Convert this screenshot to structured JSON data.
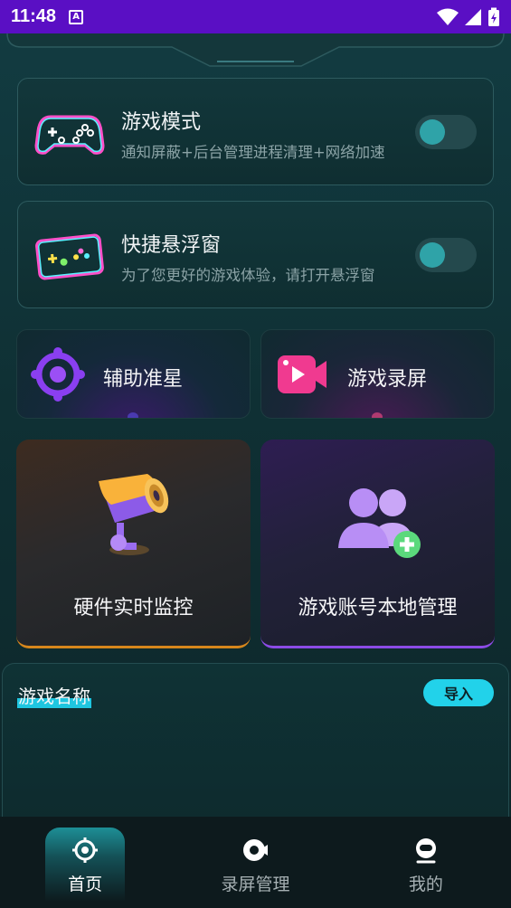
{
  "status_bar": {
    "time": "11:48",
    "notification_icon": "A"
  },
  "mode_cards": [
    {
      "title": "游戏模式",
      "subtitle": "通知屏蔽+后台管理进程清理+网络加速",
      "icon": "gamepad-icon",
      "toggle_on": false
    },
    {
      "title": "快捷悬浮窗",
      "subtitle": "为了您更好的游戏体验，请打开悬浮窗",
      "icon": "floating-window-icon",
      "toggle_on": false
    }
  ],
  "quick_cards": [
    {
      "label": "辅助准星",
      "icon": "crosshair-icon",
      "accent": "#8a3ff0"
    },
    {
      "label": "游戏录屏",
      "icon": "video-record-icon",
      "accent": "#ff3d9a"
    }
  ],
  "feature_cards": [
    {
      "label": "硬件实时监控",
      "icon": "camera-monitor-icon",
      "accent": "#d6861c"
    },
    {
      "label": "游戏账号本地管理",
      "icon": "add-user-icon",
      "accent": "#8c4be6"
    }
  ],
  "game_panel": {
    "title": "游戏名称",
    "import_label": "导入"
  },
  "nav": {
    "active": 0,
    "items": [
      {
        "label": "首页",
        "icon": "target-icon"
      },
      {
        "label": "录屏管理",
        "icon": "record-icon"
      },
      {
        "label": "我的",
        "icon": "profile-icon"
      }
    ]
  },
  "colors": {
    "status_bar": "#5a0fc4",
    "import_button": "#22d2ea",
    "toggle_knob": "#2fa3a8"
  }
}
